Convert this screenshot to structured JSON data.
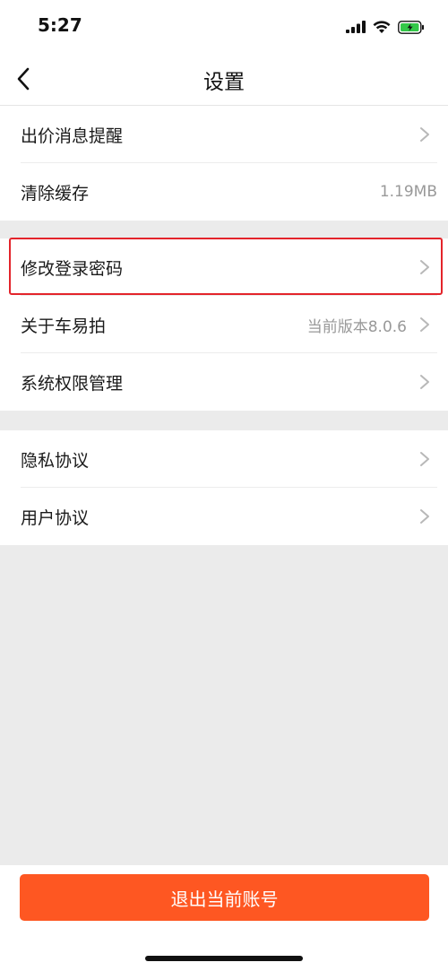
{
  "status": {
    "time": "5:27"
  },
  "header": {
    "title": "设置"
  },
  "group1": [
    {
      "label": "出价消息提醒",
      "value": ""
    },
    {
      "label": "清除缓存",
      "value": "1.19MB"
    }
  ],
  "group2": [
    {
      "label": "修改登录密码",
      "value": ""
    },
    {
      "label": "关于车易拍",
      "value": "当前版本8.0.6"
    },
    {
      "label": "系统权限管理",
      "value": ""
    }
  ],
  "group3": [
    {
      "label": "隐私协议",
      "value": ""
    },
    {
      "label": "用户协议",
      "value": ""
    }
  ],
  "footer": {
    "logout_label": "退出当前账号"
  },
  "colors": {
    "accent": "#fe5722",
    "highlight": "#e3242b",
    "background": "#ebebeb"
  },
  "icons": [
    "back-chevron-icon",
    "chevron-right-icon",
    "signal-icon",
    "wifi-icon",
    "battery-icon"
  ]
}
